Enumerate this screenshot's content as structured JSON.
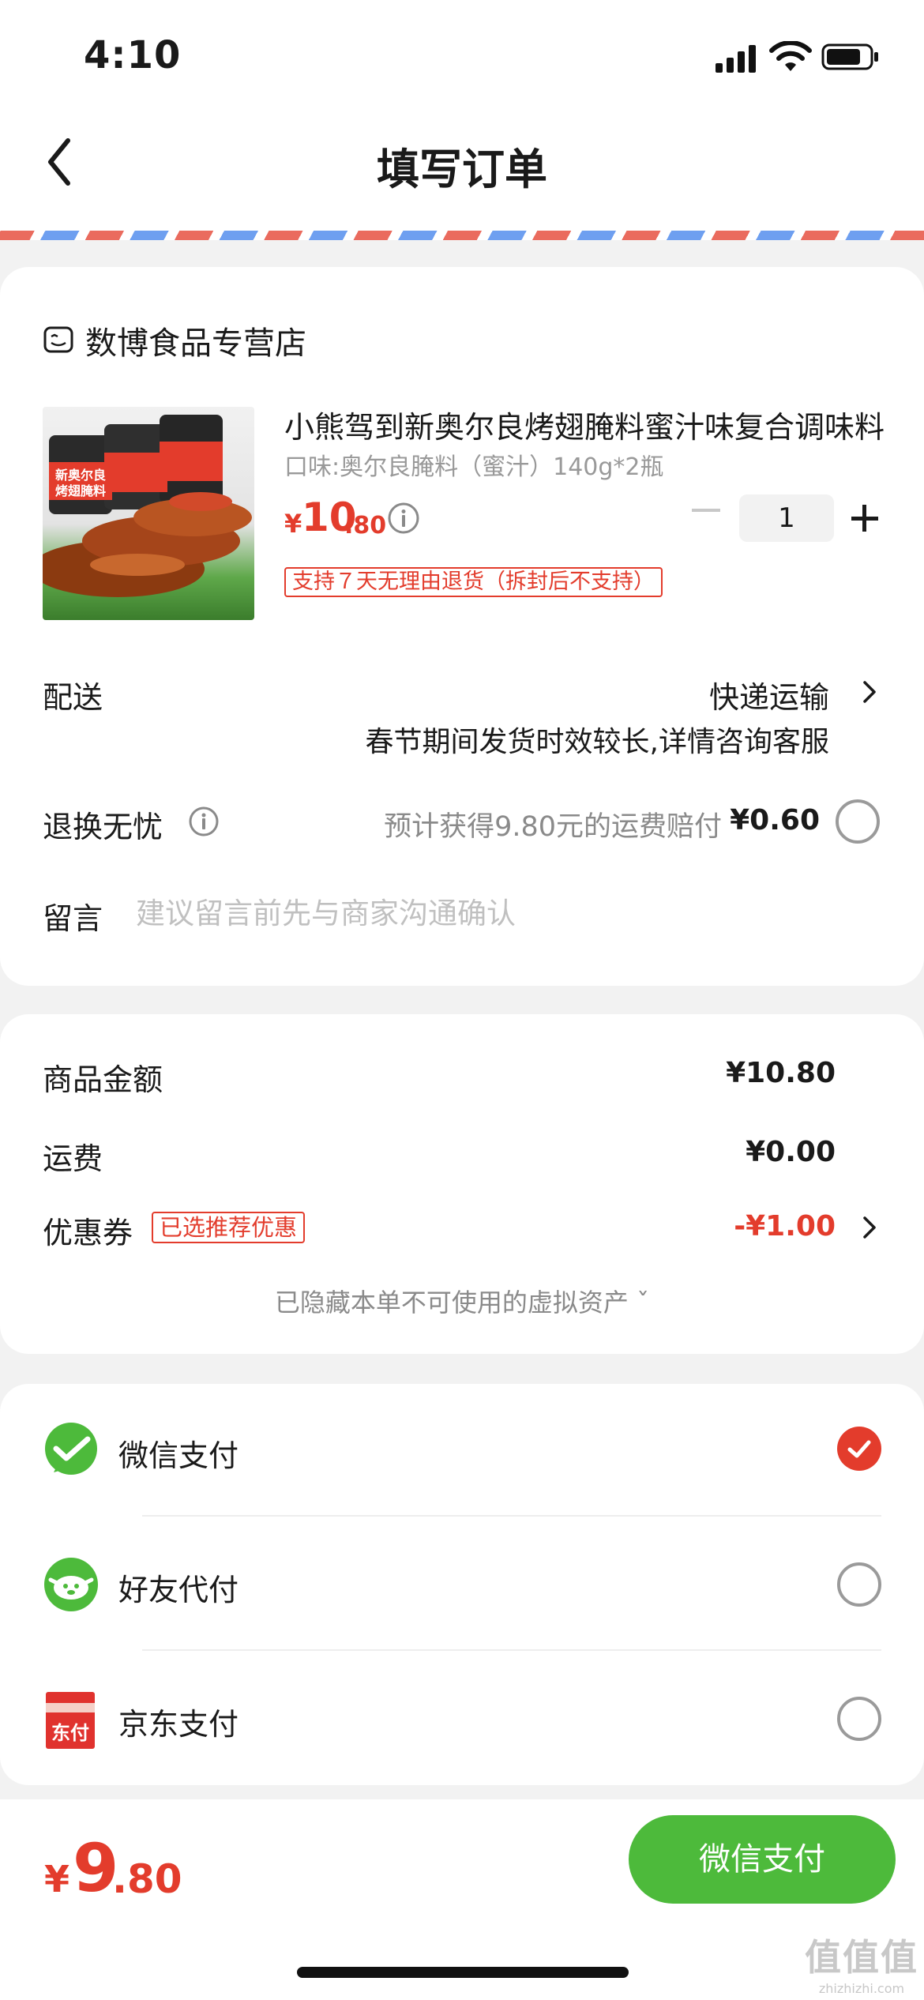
{
  "status_bar": {
    "time": "4:10"
  },
  "nav": {
    "title": "填写订单"
  },
  "store": {
    "name": "数博食品专营店"
  },
  "product": {
    "title": "小熊驾到新奥尔良烤翅腌料蜜汁味复合调味料",
    "spec": "口味:奥尔良腌料（蜜汁）140g*2瓶",
    "price_symbol": "¥",
    "price_int": "10",
    "price_dec": ".80",
    "quantity": "1",
    "return_tag": "支持７天无理由退货（拆封后不支持）"
  },
  "delivery": {
    "label": "配送",
    "method": "快递运输",
    "note": "春节期间发货时效较长,详情咨询客服"
  },
  "worry_free": {
    "label": "退换无忧",
    "desc": "预计获得9.80元的运费赔付",
    "price": "¥0.60"
  },
  "message": {
    "label": "留言",
    "placeholder": "建议留言前先与商家沟通确认"
  },
  "summary": {
    "goods_label": "商品金额",
    "goods_value": "¥10.80",
    "shipping_label": "运费",
    "shipping_value": "¥0.00",
    "coupon_label": "优惠券",
    "coupon_tag": "已选推荐优惠",
    "coupon_value": "-¥1.00",
    "hidden_assets": "已隐藏本单不可使用的虚拟资产 ˇ"
  },
  "payment": {
    "methods": [
      {
        "label": "微信支付",
        "icon": "wechat-pay-icon",
        "selected": true
      },
      {
        "label": "好友代付",
        "icon": "friend-pay-icon",
        "selected": false
      },
      {
        "label": "京东支付",
        "icon": "jd-pay-icon",
        "selected": false
      }
    ],
    "jd_icon_text": "东付"
  },
  "footer": {
    "total_symbol": "¥",
    "total_int": "9",
    "total_dec": ".80",
    "pay_button": "微信支付"
  },
  "product_image_text": [
    "新奥尔良",
    "烤翅腌料"
  ],
  "watermark": {
    "logo": "值值值",
    "url": "zhizhizhi.com"
  },
  "colors": {
    "accent_red": "#e33c2c",
    "wechat_green": "#4dba3b",
    "background": "#f2f2f2"
  }
}
